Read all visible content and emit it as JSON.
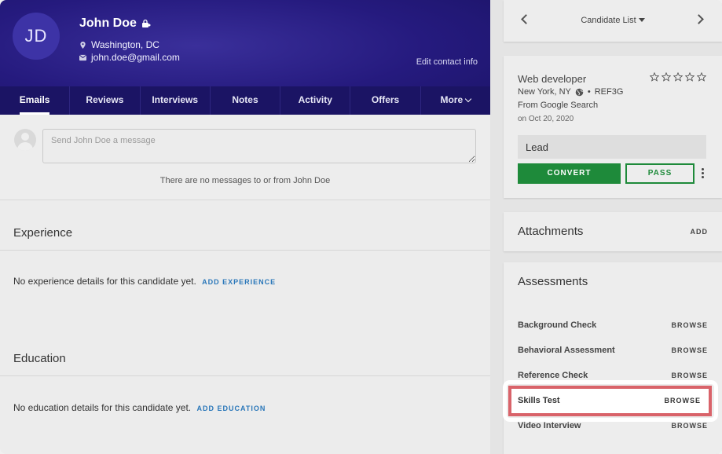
{
  "candidate": {
    "initials": "JD",
    "name": "John Doe",
    "location": "Washington, DC",
    "email": "john.doe@gmail.com",
    "edit_contact_label": "Edit contact info"
  },
  "tabs": [
    {
      "label": "Emails",
      "active": true
    },
    {
      "label": "Reviews"
    },
    {
      "label": "Interviews"
    },
    {
      "label": "Notes"
    },
    {
      "label": "Activity"
    },
    {
      "label": "Offers"
    },
    {
      "label": "More"
    }
  ],
  "messages": {
    "placeholder": "Send John Doe a message",
    "empty_text": "There are no messages to or from John Doe"
  },
  "experience": {
    "title": "Experience",
    "empty_text": "No experience details for this candidate yet.",
    "add_label": "ADD EXPERIENCE"
  },
  "education": {
    "title": "Education",
    "empty_text": "No education details for this candidate yet.",
    "add_label": "ADD EDUCATION"
  },
  "nav": {
    "title": "Candidate List"
  },
  "job": {
    "title": "Web developer",
    "rating": 0,
    "rating_max": 5,
    "location": "New York, NY",
    "ref": "REF3G",
    "source": "From Google Search",
    "date": "on Oct 20, 2020",
    "stage": "Lead",
    "convert_label": "CONVERT",
    "pass_label": "PASS"
  },
  "attachments": {
    "title": "Attachments",
    "add_label": "ADD"
  },
  "assessments": {
    "title": "Assessments",
    "items": [
      {
        "name": "Background Check",
        "action": "BROWSE"
      },
      {
        "name": "Behavioral Assessment",
        "action": "BROWSE"
      },
      {
        "name": "Reference Check",
        "action": "BROWSE"
      },
      {
        "name": "Skills Test",
        "action": "BROWSE"
      },
      {
        "name": "Video Interview",
        "action": "BROWSE"
      }
    ]
  },
  "colors": {
    "header": "#251a7e",
    "accent_green": "#1e8a3a",
    "link_blue": "#2a77b9",
    "highlight_red": "#d9636a"
  }
}
